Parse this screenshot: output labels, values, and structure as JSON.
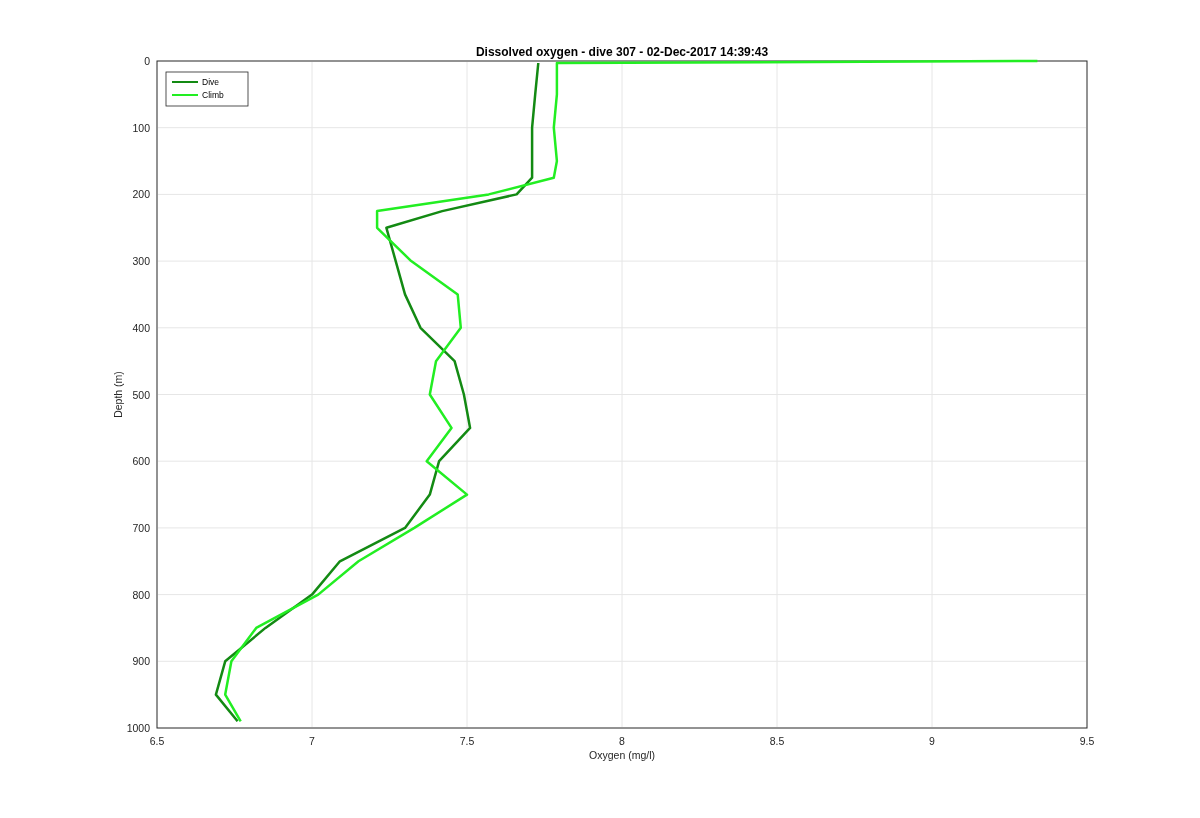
{
  "figure": {
    "chart_data": {
      "type": "line",
      "orientation": "horizontal",
      "title": "Dissolved oxygen - dive 307 - 02-Dec-2017 14:39:43",
      "xlabel": "Oxygen (mg/l)",
      "ylabel": "Depth (m)",
      "x": [
        0,
        3,
        50,
        100,
        150,
        175,
        200,
        225,
        250,
        300,
        350,
        400,
        450,
        500,
        550,
        600,
        650,
        700,
        750,
        800,
        850,
        900,
        950,
        990
      ],
      "series": [
        {
          "name": "Dive",
          "color": "#138a13",
          "values": [
            null,
            7.73,
            7.72,
            7.71,
            7.71,
            7.71,
            7.66,
            7.42,
            7.24,
            7.27,
            7.3,
            7.35,
            7.46,
            7.49,
            7.51,
            7.41,
            7.38,
            7.3,
            7.09,
            7.0,
            6.85,
            6.72,
            6.69,
            6.76
          ]
        },
        {
          "name": "Climb",
          "color": "#22ee22",
          "values": [
            9.34,
            7.79,
            7.79,
            7.78,
            7.79,
            7.78,
            7.57,
            7.21,
            7.21,
            7.32,
            7.47,
            7.48,
            7.4,
            7.38,
            7.45,
            7.37,
            7.5,
            7.33,
            7.15,
            7.02,
            6.82,
            6.74,
            6.72,
            6.77
          ]
        }
      ],
      "xlim": [
        6.5,
        9.5
      ],
      "ylim": [
        1000,
        0
      ],
      "xticks": [
        6.5,
        7,
        7.5,
        8,
        8.5,
        9,
        9.5
      ],
      "yticks": [
        0,
        100,
        200,
        300,
        400,
        500,
        600,
        700,
        800,
        900,
        1000
      ],
      "grid": true,
      "legend": true
    }
  }
}
